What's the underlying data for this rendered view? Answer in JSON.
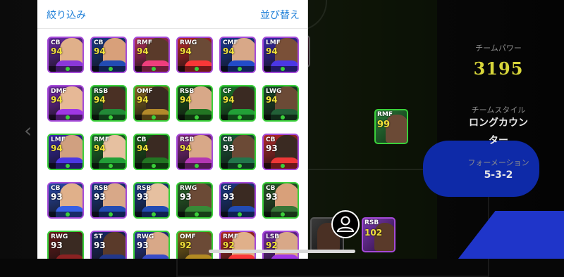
{
  "header": {
    "filter_label": "絞り込み",
    "sort_label": "並び替え"
  },
  "colors": {
    "accent": "#1e7fd8",
    "power": "#d8d63a",
    "blue_panel": "#0e2aa8",
    "green_border": "#3ad03a"
  },
  "icons": {
    "left_arrow": "chevron-left-icon",
    "avatar": "person-icon"
  },
  "player_grid": [
    {
      "position": "CB",
      "rating": "94"
    },
    {
      "position": "CB",
      "rating": "94"
    },
    {
      "position": "RMF",
      "rating": "94"
    },
    {
      "position": "RWG",
      "rating": "94"
    },
    {
      "position": "CMF",
      "rating": "94"
    },
    {
      "position": "LMF",
      "rating": "94"
    },
    {
      "position": "DMF",
      "rating": "94"
    },
    {
      "position": "RSB",
      "rating": "94"
    },
    {
      "position": "OMF",
      "rating": "94"
    },
    {
      "position": "RSB",
      "rating": "94"
    },
    {
      "position": "CF",
      "rating": "94"
    },
    {
      "position": "LWG",
      "rating": "94"
    },
    {
      "position": "LMF",
      "rating": "94"
    },
    {
      "position": "RMF",
      "rating": "94"
    },
    {
      "position": "CB",
      "rating": "94"
    },
    {
      "position": "RSB",
      "rating": "94"
    },
    {
      "position": "CB",
      "rating": "93"
    },
    {
      "position": "CB",
      "rating": "93"
    },
    {
      "position": "CB",
      "rating": "93"
    },
    {
      "position": "RSB",
      "rating": "93"
    },
    {
      "position": "RSB",
      "rating": "93"
    },
    {
      "position": "RWG",
      "rating": "93"
    },
    {
      "position": "CF",
      "rating": "93"
    },
    {
      "position": "CB",
      "rating": "93"
    },
    {
      "position": "RWG",
      "rating": "93"
    },
    {
      "position": "ST",
      "rating": "93"
    },
    {
      "position": "RWG",
      "rating": "93"
    },
    {
      "position": "OMF",
      "rating": "92"
    },
    {
      "position": "RMF",
      "rating": "92"
    },
    {
      "position": "LSB",
      "rating": "92"
    }
  ],
  "team_info": {
    "power_label": "チームパワー",
    "power_value": "3195",
    "style_label": "チームスタイル",
    "style_value_line1": "ロングカウン",
    "style_value_line2": "ター",
    "formation_label": "フォーメーション",
    "formation_value": "5-3-2"
  },
  "pitch_players": [
    {
      "position": "RMF",
      "rating": "99"
    },
    {
      "position": "RSB",
      "rating": "102"
    }
  ]
}
